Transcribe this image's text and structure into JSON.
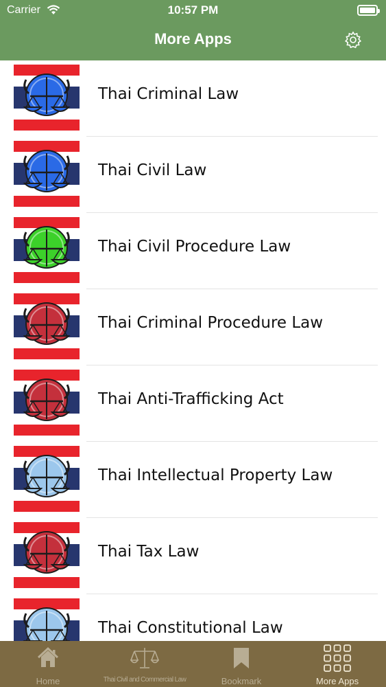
{
  "status": {
    "carrier": "Carrier",
    "time": "10:57 PM"
  },
  "nav": {
    "title": "More Apps",
    "settings_icon": "gear-icon"
  },
  "apps": [
    {
      "name": "Thai Criminal Law",
      "emblem_color": "#2a6ae6"
    },
    {
      "name": "Thai Civil Law",
      "emblem_color": "#2a6ae6"
    },
    {
      "name": "Thai Civil Procedure Law",
      "emblem_color": "#3cd12a"
    },
    {
      "name": "Thai Criminal Procedure Law",
      "emblem_color": "#c4303c"
    },
    {
      "name": "Thai Anti-Trafficking Act",
      "emblem_color": "#c4303c"
    },
    {
      "name": "Thai Intellectual Property Law",
      "emblem_color": "#9cc7ec"
    },
    {
      "name": "Thai Tax Law",
      "emblem_color": "#c4303c"
    },
    {
      "name": "Thai Constitutional Law",
      "emblem_color": "#9cc7ec"
    }
  ],
  "tabs": [
    {
      "label": "Home",
      "icon": "home-icon"
    },
    {
      "label": "Thai Civil and Commercial Law",
      "icon": "scales-icon"
    },
    {
      "label": "Bookmark",
      "icon": "bookmark-icon"
    },
    {
      "label": "More Apps",
      "icon": "grid-icon"
    }
  ],
  "colors": {
    "header": "#6b9a5f",
    "tabbar": "#7d6a43",
    "flag_red": "#e8242c",
    "flag_blue": "#27366e"
  }
}
